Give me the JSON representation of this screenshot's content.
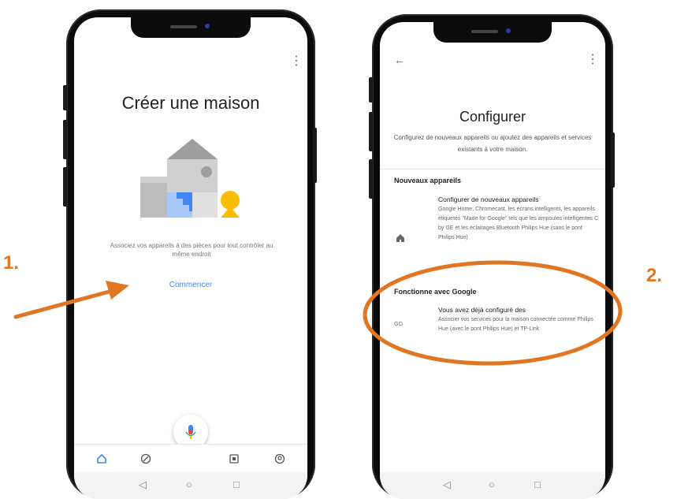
{
  "annotations": {
    "step1": "1.",
    "step2": "2.",
    "accent_color": "#e07522"
  },
  "screen1": {
    "title": "Créer une maison",
    "description": "Associez vos appareils à des pièces pour tout contrôler au même endroit",
    "start_link": "Commencer",
    "nav_icons": [
      "home-icon",
      "explore-icon",
      "mic-icon",
      "media-icon",
      "account-icon"
    ],
    "system_nav": [
      "back-icon",
      "home-circle-icon",
      "recents-icon"
    ]
  },
  "screen2": {
    "title": "Configurer",
    "subtitle": "Configurez de nouveaux appareils ou ajoutez des appareils et services existants à votre maison.",
    "new_devices_heading": "Nouveaux appareils",
    "new_devices_item_title": "Configurer de nouveaux appareils",
    "new_devices_item_desc": "Google Home, Chromecast, les écrans intelligents, les appareils étiquetés \"Made for Google\" tels que les ampoules intelligentes C by GE et les éclairages Bluetooth Philips Hue (sans le pont Philips Hue)",
    "works_with_heading": "Fonctionne avec Google",
    "works_with_item_title": "Vous avez déjà configuré des",
    "works_with_item_desc": "Associer vos services pour la maison connectée comme Philips Hue (avec le pont Philips Hue) et TP-Link",
    "works_with_icon_text": "GO"
  },
  "colors": {
    "google_blue": "#4285f4",
    "google_yellow": "#fbbc04",
    "house_grey": "#bdbdbd"
  }
}
